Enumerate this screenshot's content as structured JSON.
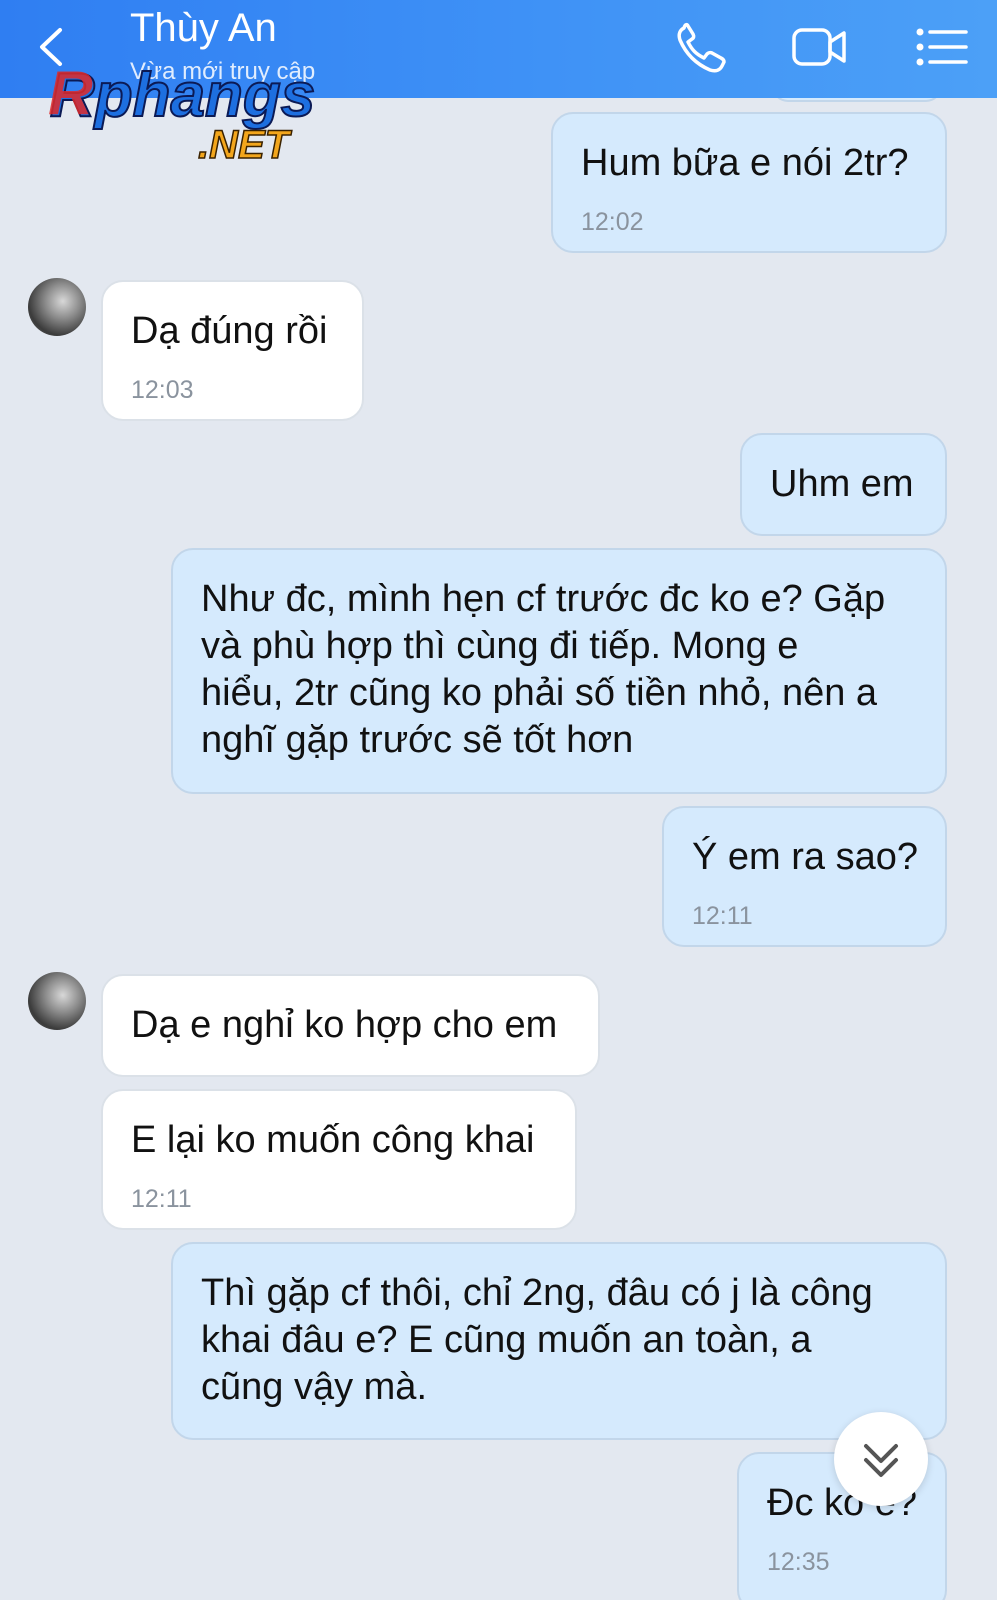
{
  "header": {
    "contact_name": "Thùy An",
    "contact_status": "Vừa mới truy cập",
    "icons": [
      "back-icon",
      "phone-icon",
      "video-icon",
      "menu-icon"
    ],
    "accent_color": "#3a8cf4"
  },
  "watermark": {
    "brand": "Rphangs",
    "suffix": ".NET"
  },
  "messages": [
    {
      "side": "out",
      "text": "Hum bữa e nói 2tr?",
      "time": "12:02"
    },
    {
      "side": "in",
      "text": "Dạ đúng rồi",
      "time": "12:03"
    },
    {
      "side": "out",
      "text": "Uhm em",
      "time": ""
    },
    {
      "side": "out",
      "text": "Như đc, mình hẹn cf trước đc ko e? Gặp\nvà phù hợp thì cùng đi tiếp. Mong e\nhiểu, 2tr cũng ko phải số tiền nhỏ, nên a\nnghĩ gặp trước sẽ tốt hơn",
      "time": ""
    },
    {
      "side": "out",
      "text": "Ý em ra sao?",
      "time": "12:11"
    },
    {
      "side": "in",
      "text": "Dạ e nghỉ ko hợp cho em",
      "time": ""
    },
    {
      "side": "in",
      "text": "E lại ko muốn công khai",
      "time": "12:11"
    },
    {
      "side": "out",
      "text": "Thì gặp cf thôi, chỉ 2ng, đâu có j là công\nkhai đâu e? E cũng muốn an toàn, a\ncũng vậy mà.",
      "time": ""
    },
    {
      "side": "out",
      "text": "Đc ko e?",
      "time": "12:35"
    }
  ],
  "scroll_down_icon": "chevron-double-down-icon"
}
